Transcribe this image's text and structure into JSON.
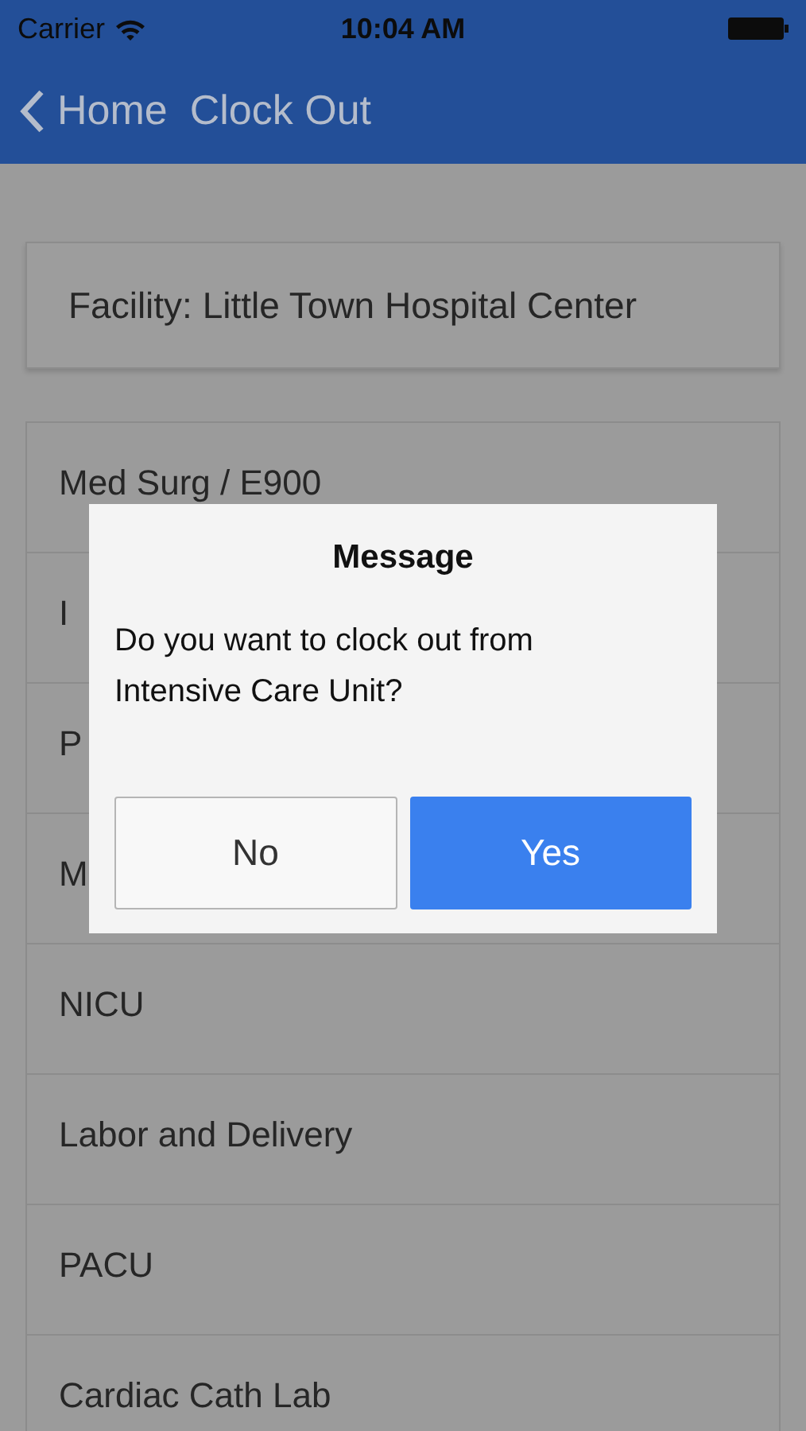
{
  "status_bar": {
    "carrier": "Carrier",
    "time": "10:04 AM"
  },
  "nav_bar": {
    "back_label": "Home",
    "title": "Clock Out"
  },
  "facility": {
    "label": "Facility: Little Town Hospital Center"
  },
  "units": [
    {
      "name": "Med Surg / E900"
    },
    {
      "name": "I"
    },
    {
      "name": "P"
    },
    {
      "name": "M"
    },
    {
      "name": "NICU"
    },
    {
      "name": "Labor and Delivery"
    },
    {
      "name": "PACU"
    },
    {
      "name": "Cardiac Cath Lab"
    }
  ],
  "dialog": {
    "title": "Message",
    "message": "Do you want to clock out from Intensive Care Unit?",
    "buttons": [
      {
        "label": "No",
        "kind": "secondary"
      },
      {
        "label": "Yes",
        "kind": "primary"
      }
    ]
  }
}
